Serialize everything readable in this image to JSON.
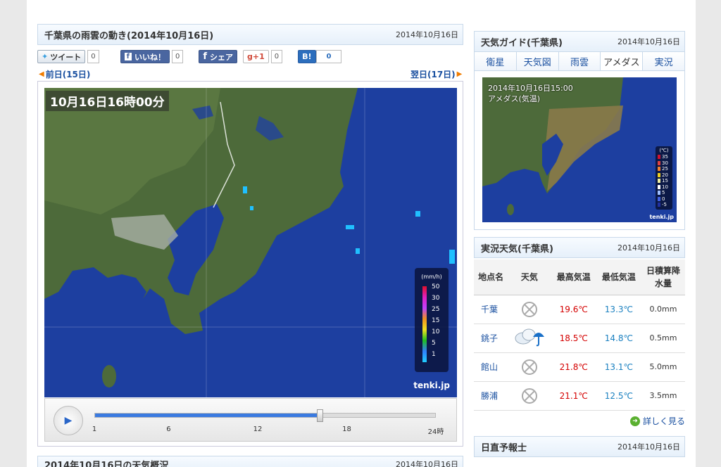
{
  "main": {
    "title": "千葉県の雨雲の動き(2014年10月16日)",
    "date": "2014年10月16日",
    "prev_day": "前日(15日)",
    "next_day": "翌日(17日)",
    "map_time": "10月16日16時00分",
    "legend_unit": "(mm/h)",
    "legend_levels": [
      "50",
      "30",
      "25",
      "15",
      "10",
      "5",
      "1"
    ],
    "map_logo": "tenki.jp",
    "play_icon": "play-icon",
    "timeline_ticks": [
      "1",
      "6",
      "12",
      "18",
      "24時"
    ],
    "timeline_progress": 0.66
  },
  "social": {
    "tweet_label": "ツイート",
    "tweet_count": "0",
    "like_label": "いいね！",
    "like_count": "0",
    "share_label": "シェア",
    "gplus_label": "g+1",
    "gplus_count": "0",
    "hatena_label": "B!",
    "hatena_count": "0"
  },
  "bottom": {
    "title": "2014年10月16日の天気概況",
    "date": "2014年10月16日"
  },
  "guide": {
    "title": "天気ガイド(千葉県)",
    "date": "2014年10月16日",
    "tabs": [
      "衛星",
      "天気図",
      "雨雲",
      "アメダス",
      "実況"
    ],
    "active_tab": "アメダス",
    "map_time": "2014年10月16日15:00",
    "map_caption": "アメダス(気温)",
    "legend_unit": "(℃)",
    "legend_levels": [
      "35",
      "30",
      "25",
      "20",
      "15",
      "10",
      "5",
      "0",
      "-5"
    ],
    "map_logo": "tenki.jp"
  },
  "observation": {
    "title": "実況天気(千葉県)",
    "date": "2014年10月16日",
    "headers": [
      "地点名",
      "天気",
      "最高気温",
      "最低気温",
      "日積算降水量"
    ],
    "rows": [
      {
        "name": "千葉",
        "weather_icon": "clear-icon",
        "high": "19.6℃",
        "low": "13.3℃",
        "precip": "0.0mm"
      },
      {
        "name": "銚子",
        "weather_icon": "cloud-rain-icon",
        "high": "18.5℃",
        "low": "14.8℃",
        "precip": "0.5mm"
      },
      {
        "name": "館山",
        "weather_icon": "clear-icon",
        "high": "21.8℃",
        "low": "13.1℃",
        "precip": "5.0mm"
      },
      {
        "name": "勝浦",
        "weather_icon": "clear-icon",
        "high": "21.1℃",
        "low": "12.5℃",
        "precip": "3.5mm"
      }
    ],
    "more_label": "詳しく見る"
  },
  "forecaster": {
    "title": "日直予報士",
    "date": "2014年10月16日"
  }
}
